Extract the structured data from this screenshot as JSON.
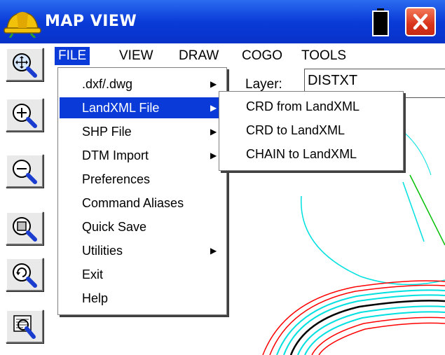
{
  "window": {
    "title": "MAP VIEW",
    "logo_icon": "hardhat-logo-icon",
    "battery_icon": "battery-icon",
    "close_icon": "close-icon"
  },
  "menubar": {
    "items": [
      {
        "label": "FILE",
        "active": true
      },
      {
        "label": "VIEW"
      },
      {
        "label": "DRAW"
      },
      {
        "label": "COGO"
      },
      {
        "label": "TOOLS"
      }
    ]
  },
  "layer": {
    "label": "Layer:",
    "value": "DISTXT"
  },
  "toolbar": {
    "tools": [
      "zoom-extents-icon",
      "zoom-in-icon",
      "zoom-out-icon",
      "zoom-window-icon",
      "zoom-previous-icon",
      "map-tools-icon"
    ]
  },
  "file_menu": {
    "items": [
      {
        "label": ".dxf/.dwg",
        "submenu": true
      },
      {
        "label": "LandXML File",
        "submenu": true,
        "highlighted": true
      },
      {
        "label": "SHP File",
        "submenu": true
      },
      {
        "label": "DTM Import",
        "submenu": true
      },
      {
        "label": "Preferences"
      },
      {
        "label": "Command Aliases"
      },
      {
        "label": "Quick Save"
      },
      {
        "label": "Utilities",
        "submenu": true
      },
      {
        "label": "Exit"
      },
      {
        "label": "Help"
      }
    ]
  },
  "landxml_submenu": {
    "items": [
      {
        "label": "CRD from LandXML"
      },
      {
        "label": "CRD to LandXML"
      },
      {
        "label": "CHAIN to LandXML"
      }
    ]
  },
  "colors": {
    "title_bar": "#0a3bd8",
    "highlight": "#0a3bd8",
    "close_button": "#d8341a",
    "map_red": "#ff0000",
    "map_cyan": "#00e0e0",
    "map_green": "#00c000",
    "map_black": "#000000"
  }
}
